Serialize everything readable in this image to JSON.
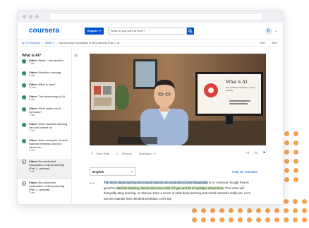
{
  "brand": {
    "logo": "coursera"
  },
  "header": {
    "explore_label": "Explore",
    "search_placeholder": "What do you want to learn?",
    "avatar_initial": "K"
  },
  "breadcrumbs": {
    "items": [
      "AI For Everyone",
      "Week 1",
      "Non-technical explanation of deep learning (Part 1, op"
    ],
    "actions": [
      "Prev",
      "Next"
    ]
  },
  "sidebar": {
    "title": "What is AI?",
    "items": [
      {
        "prefix": "Video:",
        "title": "Week 1 Introduction",
        "duration": "7 min",
        "state": "done"
      },
      {
        "prefix": "Video:",
        "title": "Machine Learning",
        "duration": "6 min",
        "state": "done"
      },
      {
        "prefix": "Video:",
        "title": "What is data?",
        "duration": "11 min",
        "state": "done"
      },
      {
        "prefix": "Video:",
        "title": "The terminology of AI",
        "duration": "9 min",
        "state": "done"
      },
      {
        "prefix": "Video:",
        "title": "What makes an AI company?",
        "duration": "7 min",
        "state": "done"
      },
      {
        "prefix": "Video:",
        "title": "What machine learning can and cannot do",
        "duration": "7 min",
        "state": "done"
      },
      {
        "prefix": "Video:",
        "title": "More examples of what machine learning can and cannot do",
        "duration": "8 min",
        "state": "done"
      },
      {
        "prefix": "Video:",
        "title": "Non-technical explanation of deep learning (Part 1, optional)",
        "duration": "7 min",
        "state": "active"
      },
      {
        "prefix": "Video:",
        "title": "Non-technical explanation of deep learning (Part 2, optional)",
        "duration": "3 min",
        "state": "next"
      }
    ]
  },
  "video": {
    "slide_title": "What is AI",
    "slide_subtitle": "Non-technical explanation of deep learning"
  },
  "toolbar": {
    "save_note": "Save Note",
    "discuss": "Discuss",
    "download": "Download"
  },
  "transcript": {
    "language": "English",
    "help_link": "Help Us Translate",
    "timestamp": "0:01",
    "seg_1": "The terms deep learning and neural network are used almost interchangeably",
    "seg_2": " in AI. And even though they're great for ",
    "seg_3": "machine learning, there's also been a bit of hype and bit of mystique about them.",
    "seg_4": " This video will demystify deep learning, so that you have a sense of what deep learning and neural networks really are. Let's use an example from demand prediction. Let's say"
  },
  "colors": {
    "brand_blue": "#0056d2",
    "complete_green": "#1f8354",
    "accent_orange": "#f2a356"
  }
}
